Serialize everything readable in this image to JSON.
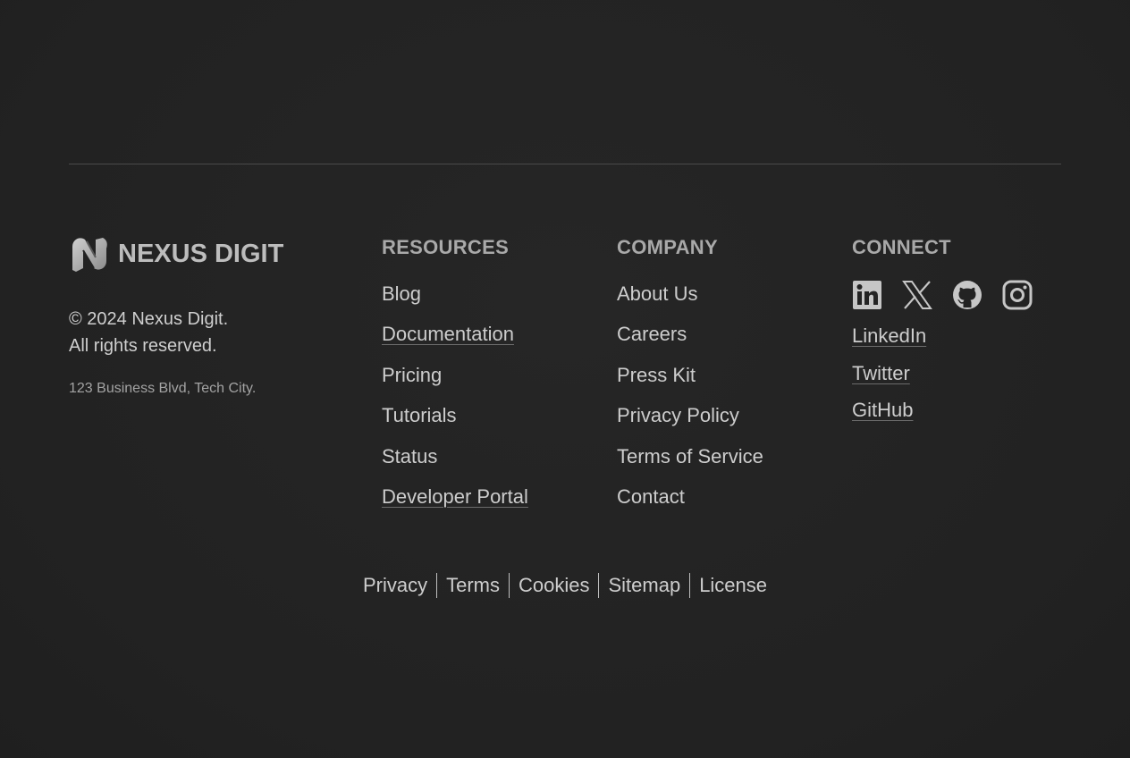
{
  "brand": {
    "name": "NEXUS DIGIT",
    "copyright_line1": "© 2024 Nexus Digit.",
    "copyright_line2": "All rights reserved.",
    "address": "123 Business Blvd, Tech City."
  },
  "resources": {
    "heading": "RESOURCES",
    "links": [
      {
        "label": "Blog",
        "underlined": false
      },
      {
        "label": "Documentation",
        "underlined": true
      },
      {
        "label": "Pricing",
        "underlined": false
      },
      {
        "label": "Tutorials",
        "underlined": false
      },
      {
        "label": "Status",
        "underlined": false
      },
      {
        "label": "Developer Portal",
        "underlined": true
      }
    ]
  },
  "company": {
    "heading": "COMPANY",
    "links": [
      {
        "label": "About Us"
      },
      {
        "label": "Careers"
      },
      {
        "label": "Press Kit"
      },
      {
        "label": "Privacy Policy"
      },
      {
        "label": "Terms of Service"
      },
      {
        "label": "Contact"
      }
    ]
  },
  "connect": {
    "heading": "CONNECT",
    "icons": [
      "linkedin-icon",
      "x-twitter-icon",
      "github-icon",
      "instagram-icon"
    ],
    "links": [
      {
        "label": "LinkedIn"
      },
      {
        "label": "Twitter"
      },
      {
        "label": "GitHub"
      }
    ]
  },
  "legal": {
    "links": [
      {
        "label": "Privacy"
      },
      {
        "label": "Terms"
      },
      {
        "label": "Cookies"
      },
      {
        "label": "Sitemap"
      },
      {
        "label": "License"
      }
    ]
  },
  "colors": {
    "background": "#232323",
    "text": "#cdcdcd",
    "heading": "#a9a9a9",
    "divider": "#4a4a4a"
  }
}
